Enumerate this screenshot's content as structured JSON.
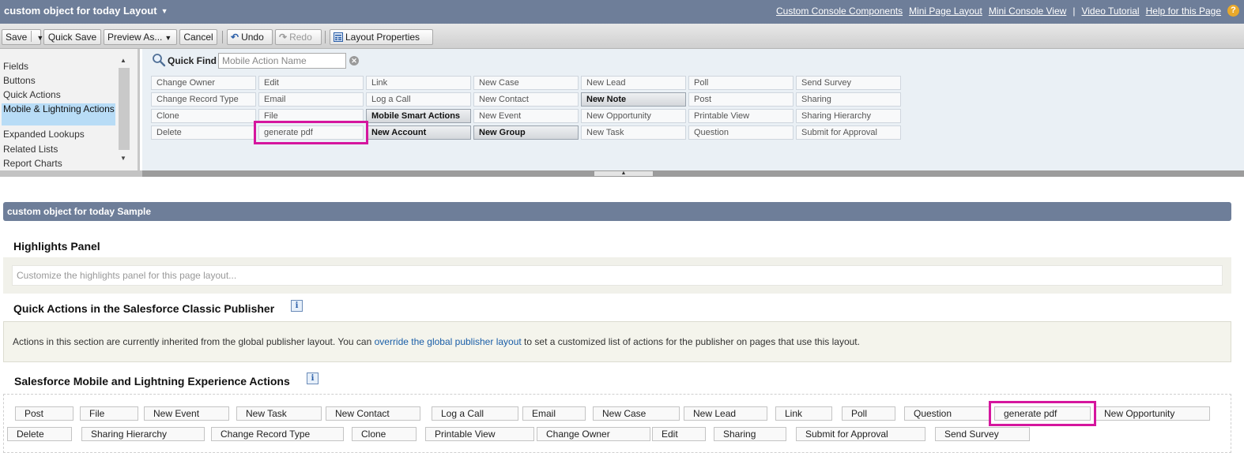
{
  "header": {
    "title": "custom object for today Layout",
    "links": [
      "Custom Console Components",
      "Mini Page Layout",
      "Mini Console View",
      "Video Tutorial",
      "Help for this Page"
    ],
    "separator": "|",
    "help_icon": "question-circle-icon"
  },
  "toolbar": {
    "save": "Save",
    "quick_save": "Quick Save",
    "preview_as": "Preview As...",
    "cancel": "Cancel",
    "undo": "Undo",
    "redo": "Redo",
    "layout_properties": "Layout Properties"
  },
  "palette": {
    "categories": [
      "Fields",
      "Buttons",
      "Quick Actions",
      "Mobile & Lightning Actions",
      "Expanded Lookups",
      "Related Lists",
      "Report Charts"
    ],
    "selected_category": "Mobile & Lightning Actions",
    "quick_find_label": "Quick Find",
    "quick_find_placeholder": "Mobile Action Name",
    "items": [
      {
        "label": "Change Owner",
        "used": false
      },
      {
        "label": "Edit",
        "used": false
      },
      {
        "label": "Link",
        "used": false
      },
      {
        "label": "New Case",
        "used": false
      },
      {
        "label": "New Lead",
        "used": false
      },
      {
        "label": "Poll",
        "used": false
      },
      {
        "label": "Send Survey",
        "used": false
      },
      {
        "label": "Change Record Type",
        "used": false
      },
      {
        "label": "Email",
        "used": false
      },
      {
        "label": "Log a Call",
        "used": false
      },
      {
        "label": "New Contact",
        "used": false
      },
      {
        "label": "New Note",
        "used": true
      },
      {
        "label": "Post",
        "used": false
      },
      {
        "label": "Sharing",
        "used": false
      },
      {
        "label": "Clone",
        "used": false
      },
      {
        "label": "File",
        "used": false
      },
      {
        "label": "Mobile Smart Actions",
        "used": true
      },
      {
        "label": "New Event",
        "used": false
      },
      {
        "label": "New Opportunity",
        "used": false
      },
      {
        "label": "Printable View",
        "used": false
      },
      {
        "label": "Sharing Hierarchy",
        "used": false
      },
      {
        "label": "Delete",
        "used": false
      },
      {
        "label": "generate pdf",
        "used": false,
        "highlighted": true
      },
      {
        "label": "New Account",
        "used": true
      },
      {
        "label": "New Group",
        "used": true
      },
      {
        "label": "New Task",
        "used": false
      },
      {
        "label": "Question",
        "used": false
      },
      {
        "label": "Submit for Approval",
        "used": false
      }
    ],
    "highlight_color": "#d5169e"
  },
  "layout": {
    "sample_header": "custom object for today Sample",
    "highlights_title": "Highlights Panel",
    "highlights_placeholder": "Customize the highlights panel for this page layout...",
    "classic_title": "Quick Actions in the Salesforce Classic Publisher",
    "classic_text_before": "Actions in this section are currently inherited from the global publisher layout. You can ",
    "classic_link": "override the global publisher layout",
    "classic_text_after": " to set a customized list of actions for the publisher on pages that use this layout.",
    "mobile_title": "Salesforce Mobile and Lightning Experience Actions",
    "mobile_actions_row1": [
      "Post",
      "File",
      "New Event",
      "New Task",
      "New Contact",
      "Log a Call",
      "Email",
      "New Case",
      "New Lead",
      "Link",
      "Poll",
      "Question",
      "generate pdf",
      "New Opportunity"
    ],
    "mobile_actions_row2": [
      "Delete",
      "Sharing Hierarchy",
      "Change Record Type",
      "Clone",
      "Printable View",
      "Change Owner",
      "Edit",
      "Sharing",
      "Submit for Approval",
      "Send Survey"
    ],
    "highlighted_action": "generate pdf"
  },
  "colors": {
    "header_bg": "#6e7e99",
    "selected_category_bg": "#b8dcf6",
    "link": "#1a5ea8",
    "highlight": "#d5169e"
  }
}
